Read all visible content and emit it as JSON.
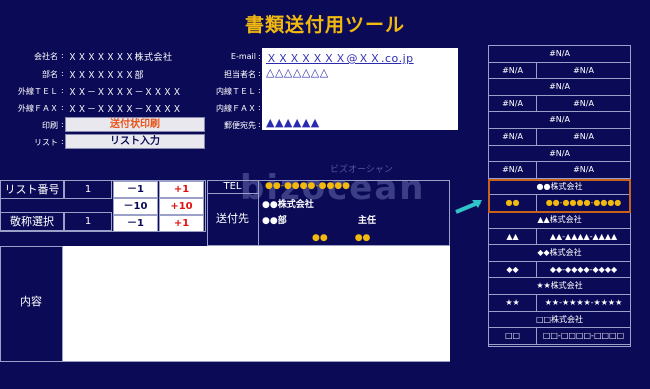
{
  "app": {
    "title": "書類送付用ツール"
  },
  "form_left": {
    "company_label": "会社名",
    "company_value": "ＸＸＸＸＸＸＸ株式会社",
    "dept_label": "部名",
    "dept_value": "ＸＸＸＸＸＸＸ部",
    "tel_label": "外線ＴＥＬ",
    "tel_value": "ＸＸ－ＸＸＸＸ－ＸＸＸＸ",
    "fax_label": "外線ＦＡＸ",
    "fax_value": "ＸＸ－ＸＸＸＸ－ＸＸＸＸ",
    "print_label": "印刷",
    "print_button": "送付状印刷",
    "list_label": "リスト",
    "list_button": "リスト入力"
  },
  "form_right": {
    "email_label": "E-mail",
    "email_value": "ＸＸＸＸＸＸＸ@ＸＸ.co.jp",
    "person_label": "担当者名",
    "person_value": "△△△△△△△",
    "ext_tel_label": "内線ＴＥＬ",
    "ext_fax_label": "内線ＦＡＸ",
    "stamp_label": "郵便宛先",
    "stamp_value": "▲▲▲▲▲▲"
  },
  "controls": {
    "list_no_label": "リスト番号",
    "list_no_value": "1",
    "honorific_label": "敬称選択",
    "honorific_value": "1",
    "minus1": "－1",
    "plus1": "+1",
    "minus10": "－10",
    "plus10": "+10",
    "minus1b": "－1",
    "plus1b": "+1"
  },
  "dest": {
    "tel_label": "TEL",
    "tel_value": "●●-●●●●-●●●●",
    "dest_label": "送付先",
    "company": "●●株式会社",
    "dept": "●●部",
    "title": "主任",
    "name": "●●　　　●●"
  },
  "content": {
    "label": "内容"
  },
  "watermark": {
    "logo": "bizocean",
    "kana": "ビズオーシャン"
  },
  "right_list": [
    {
      "full": "#N/A"
    },
    {
      "a": "#N/A",
      "b": "#N/A"
    },
    {
      "full": "#N/A"
    },
    {
      "a": "#N/A",
      "b": "#N/A"
    },
    {
      "full": "#N/A"
    },
    {
      "a": "#N/A",
      "b": "#N/A"
    },
    {
      "full": "#N/A"
    },
    {
      "a": "#N/A",
      "b": "#N/A"
    },
    {
      "full": "●●株式会社"
    },
    {
      "a": "●●",
      "b": "●●-●●●●-●●●●"
    },
    {
      "full": "▲▲株式会社"
    },
    {
      "a": "▲▲",
      "b": "▲▲-▲▲▲▲-▲▲▲▲"
    },
    {
      "full": "◆◆株式会社"
    },
    {
      "a": "◆◆",
      "b": "◆◆-◆◆◆◆-◆◆◆◆"
    },
    {
      "full": "★★株式会社"
    },
    {
      "a": "★★",
      "b": "★★-★★★★-★★★★"
    },
    {
      "full": "□□株式会社"
    },
    {
      "a": "□□",
      "b": "□□-□□□□-□□□□"
    }
  ],
  "colors": {
    "bg": "#0b0a57",
    "accent": "#f2b90f",
    "highlight_border": "#c8621a",
    "button_red": "#e01010"
  }
}
